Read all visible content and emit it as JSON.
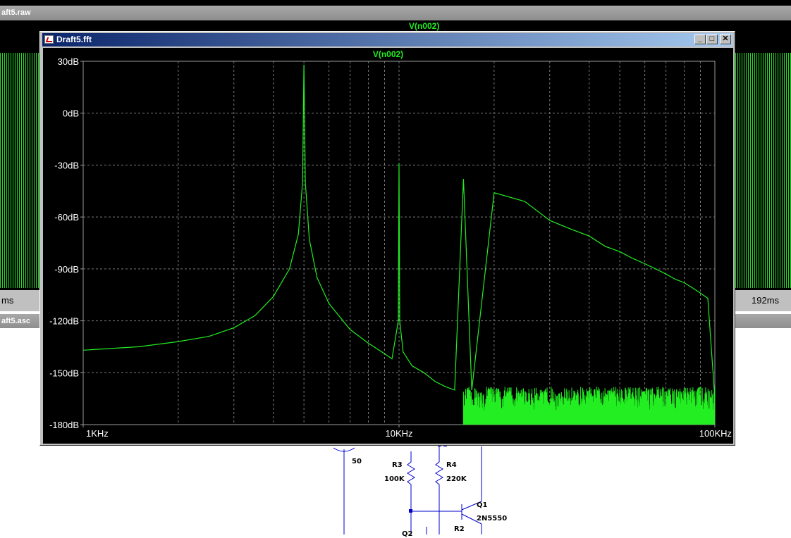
{
  "background_raw": {
    "title": "aft5.raw",
    "trace_label": "V(n002)",
    "axis_left": "ms",
    "axis_right": "192ms"
  },
  "background_asc": {
    "title": "aft5.asc",
    "labels": {
      "source_value": "50",
      "r3_name": "R3",
      "r3_value": "100K",
      "r4_name": "R4",
      "r4_value": "220K",
      "q1_name": "Q1",
      "q1_model": "2N5550",
      "r2_name": "R2",
      "q2_name": "Q2"
    }
  },
  "fft_window": {
    "title": "Draft5.fft",
    "buttons": {
      "minimize": "_",
      "maximize": "□",
      "close": "✕"
    },
    "trace_label": "V(n002)"
  },
  "chart_data": {
    "type": "line",
    "title": "V(n002)",
    "xlabel": "",
    "ylabel": "",
    "x_scale": "log",
    "xlim": [
      1000,
      100000
    ],
    "ylim": [
      -180,
      30
    ],
    "grid": true,
    "y_tick_labels": [
      "30dB",
      "0dB",
      "-30dB",
      "-60dB",
      "-90dB",
      "-120dB",
      "-150dB",
      "-180dB"
    ],
    "x_tick_labels": [
      "1KHz",
      "10KHz",
      "100KHz"
    ],
    "color": "#22ee22",
    "series": [
      {
        "x": [
          1000,
          1500,
          2000,
          2500,
          3000,
          3500,
          4000,
          4500,
          4800,
          4950,
          5000,
          5050,
          5200,
          5500,
          6000,
          7000,
          8000,
          9000,
          9500,
          9950,
          10000,
          10050,
          10300,
          11000,
          12000,
          13000,
          14000,
          15000,
          16000,
          17000,
          20000,
          25000,
          30000,
          35000,
          40000,
          45000,
          50000,
          55000,
          60000,
          65000,
          70000,
          75000,
          80000,
          85000,
          90000,
          95000,
          100000
        ],
        "y": [
          -137,
          -135,
          -132,
          -129,
          -124,
          -117,
          -106,
          -90,
          -70,
          -40,
          28,
          -40,
          -73,
          -95,
          -110,
          -125,
          -133,
          -139,
          -142,
          -120,
          -29,
          -120,
          -138,
          -146,
          -150,
          -155,
          -158,
          -160,
          -38,
          -160,
          -46,
          -51,
          -62,
          -67,
          -71,
          -77,
          -80,
          -84,
          -87,
          -90,
          -93,
          -96,
          -98,
          -101,
          -104,
          -107,
          -165
        ]
      }
    ]
  }
}
